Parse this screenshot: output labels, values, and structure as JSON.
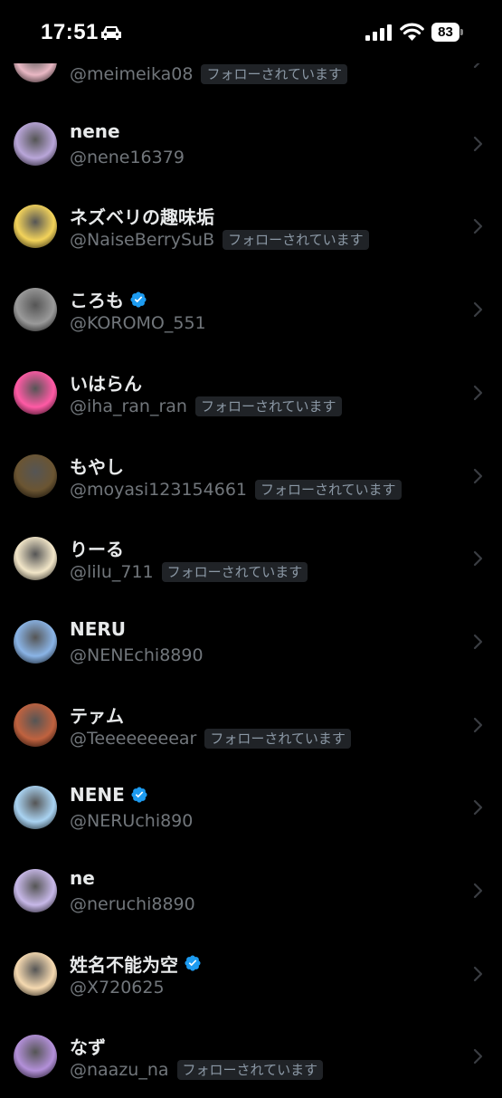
{
  "status_bar": {
    "time": "17:51",
    "battery": "83"
  },
  "follows_you_label": "フォローされています",
  "users": [
    {
      "name": "",
      "handle": "@meimeika08",
      "verified": false,
      "follows_you": true,
      "avatar_color": "#e9b8c4"
    },
    {
      "name": "nene",
      "handle": "@nene16379",
      "verified": false,
      "follows_you": false,
      "avatar_color": "#b9a6d9"
    },
    {
      "name": "ネズベリの趣味垢",
      "handle": "@NaiseBerrySuB",
      "verified": false,
      "follows_you": true,
      "avatar_color": "#f3d35a"
    },
    {
      "name": "ころも",
      "handle": "@KOROMO_551",
      "verified": true,
      "follows_you": false,
      "avatar_color": "#9a9a9a"
    },
    {
      "name": "いはらん",
      "handle": "@iha_ran_ran",
      "verified": false,
      "follows_you": true,
      "avatar_color": "#ff5aa5"
    },
    {
      "name": "もやし",
      "handle": "@moyasi123154661",
      "verified": false,
      "follows_you": true,
      "avatar_color": "#6b5532"
    },
    {
      "name": "りーる",
      "handle": "@lilu_711",
      "verified": false,
      "follows_you": true,
      "avatar_color": "#f2e6c8"
    },
    {
      "name": "NERU",
      "handle": "@NENEchi8890",
      "verified": false,
      "follows_you": false,
      "avatar_color": "#8ab4e6"
    },
    {
      "name": "テァム",
      "handle": "@Teeeeeeeear",
      "verified": false,
      "follows_you": true,
      "avatar_color": "#c0623f"
    },
    {
      "name": "NENE",
      "handle": "@NERUchi890",
      "verified": true,
      "follows_you": false,
      "avatar_color": "#a9d3f2"
    },
    {
      "name": "ne",
      "handle": "@neruchi8890",
      "verified": false,
      "follows_you": false,
      "avatar_color": "#c7b8e8"
    },
    {
      "name": "姓名不能为空",
      "handle": "@X720625",
      "verified": true,
      "follows_you": false,
      "avatar_color": "#f5d9b0"
    },
    {
      "name": "なず",
      "handle": "@naazu_na",
      "verified": false,
      "follows_you": true,
      "avatar_color": "#b390d9"
    }
  ],
  "colors": {
    "background": "#000000",
    "verified": "#1d9bf0",
    "muted": "#71767b"
  }
}
